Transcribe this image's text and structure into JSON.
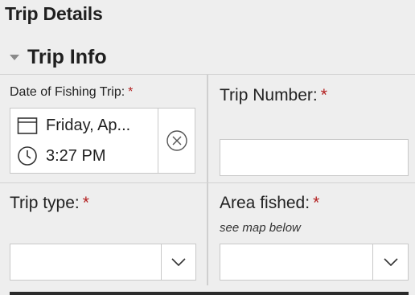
{
  "page": {
    "title": "Trip Details"
  },
  "section": {
    "title": "Trip Info"
  },
  "fields": {
    "date": {
      "label": "Date of Fishing Trip:",
      "required_mark": "*",
      "date_value": "Friday, Ap...",
      "time_value": "3:27 PM"
    },
    "trip_number": {
      "label": "Trip Number:",
      "required_mark": "*",
      "value": ""
    },
    "trip_type": {
      "label": "Trip type:",
      "required_mark": "*",
      "value": ""
    },
    "area_fished": {
      "label": "Area fished:",
      "required_mark": "*",
      "hint": "see map below",
      "value": ""
    }
  },
  "icons": {
    "section_toggle": "caret-down-icon",
    "date": "calendar-icon",
    "time": "clock-icon",
    "clear": "clear-circle-icon",
    "dropdown": "chevron-down-icon"
  },
  "colors": {
    "required": "#b32020",
    "background": "#eeeeee",
    "border": "#c8c8c8"
  }
}
